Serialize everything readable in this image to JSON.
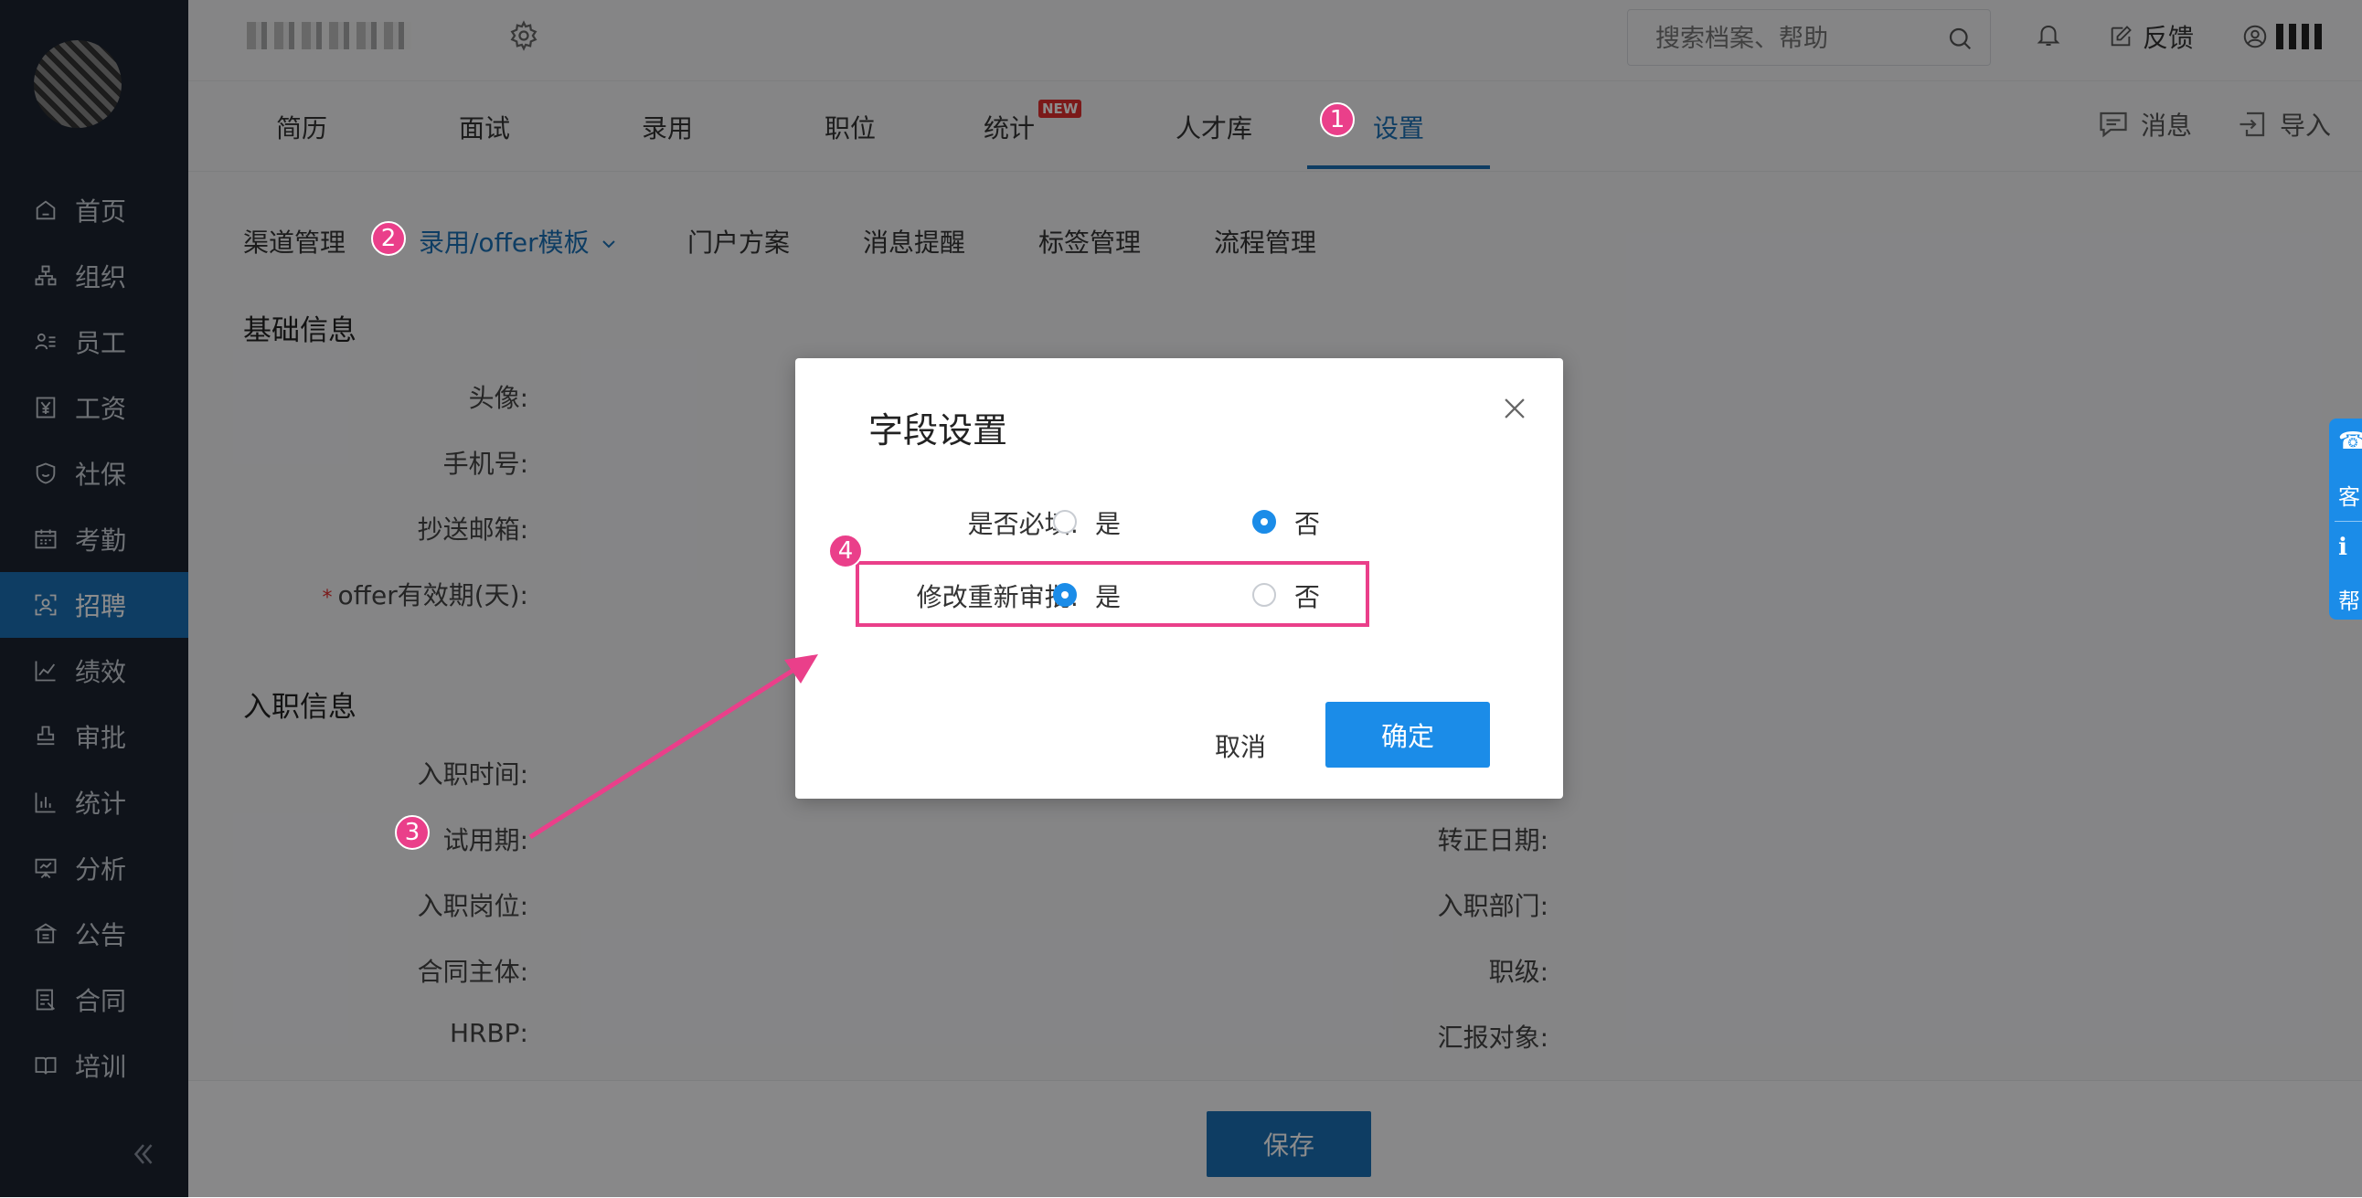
{
  "sidebar": {
    "items": [
      {
        "label": "首页",
        "icon": "home-icon"
      },
      {
        "label": "组织",
        "icon": "org-icon"
      },
      {
        "label": "员工",
        "icon": "employee-icon"
      },
      {
        "label": "工资",
        "icon": "salary-icon"
      },
      {
        "label": "社保",
        "icon": "shield-icon"
      },
      {
        "label": "考勤",
        "icon": "calendar-icon"
      },
      {
        "label": "招聘",
        "icon": "recruit-icon",
        "active": true
      },
      {
        "label": "绩效",
        "icon": "chart-line-icon"
      },
      {
        "label": "审批",
        "icon": "stamp-icon"
      },
      {
        "label": "统计",
        "icon": "bar-chart-icon"
      },
      {
        "label": "分析",
        "icon": "presentation-icon"
      },
      {
        "label": "公告",
        "icon": "notice-icon"
      },
      {
        "label": "合同",
        "icon": "contract-icon"
      },
      {
        "label": "培训",
        "icon": "book-icon"
      }
    ]
  },
  "header": {
    "search_placeholder": "搜索档案、帮助",
    "feedback_label": "反馈"
  },
  "tabs": [
    {
      "label": "简历"
    },
    {
      "label": "面试"
    },
    {
      "label": "录用"
    },
    {
      "label": "职位"
    },
    {
      "label": "统计",
      "badge": "NEW"
    },
    {
      "label": "人才库"
    },
    {
      "label": "设置",
      "active": true
    }
  ],
  "tab_actions": {
    "messages": "消息",
    "import": "导入"
  },
  "subnav": [
    {
      "label": "渠道管理"
    },
    {
      "label": "录用/offer模板",
      "active": true
    },
    {
      "label": "门户方案"
    },
    {
      "label": "消息提醒"
    },
    {
      "label": "标签管理"
    },
    {
      "label": "流程管理"
    }
  ],
  "form": {
    "basic_title": "基础信息",
    "basic_fields": [
      "头像:",
      "手机号:",
      "抄送邮箱:",
      "offer有效期(天):"
    ],
    "onboard_title": "入职信息",
    "onboard_left": [
      "入职时间:",
      "试用期:",
      "入职岗位:",
      "合同主体:",
      "HRBP:"
    ],
    "onboard_right": [
      "转正日期:",
      "入职部门:",
      "职级:",
      "汇报对象:"
    ],
    "save_label": "保存"
  },
  "float_widget": {
    "service": "客",
    "help": "帮"
  },
  "markers": [
    "1",
    "2",
    "3",
    "4"
  ],
  "modal": {
    "title": "字段设置",
    "row1_label": "是否必填:",
    "row2_label": "修改重新审批:",
    "yes": "是",
    "no": "否",
    "row1_value": "否",
    "row2_value": "是",
    "cancel": "取消",
    "ok": "确定"
  },
  "colors": {
    "accent": "#1b6fb5",
    "primary_button": "#1b8ce8",
    "annotation": "#ea3f8a",
    "sidebar_bg": "#1c2431"
  }
}
